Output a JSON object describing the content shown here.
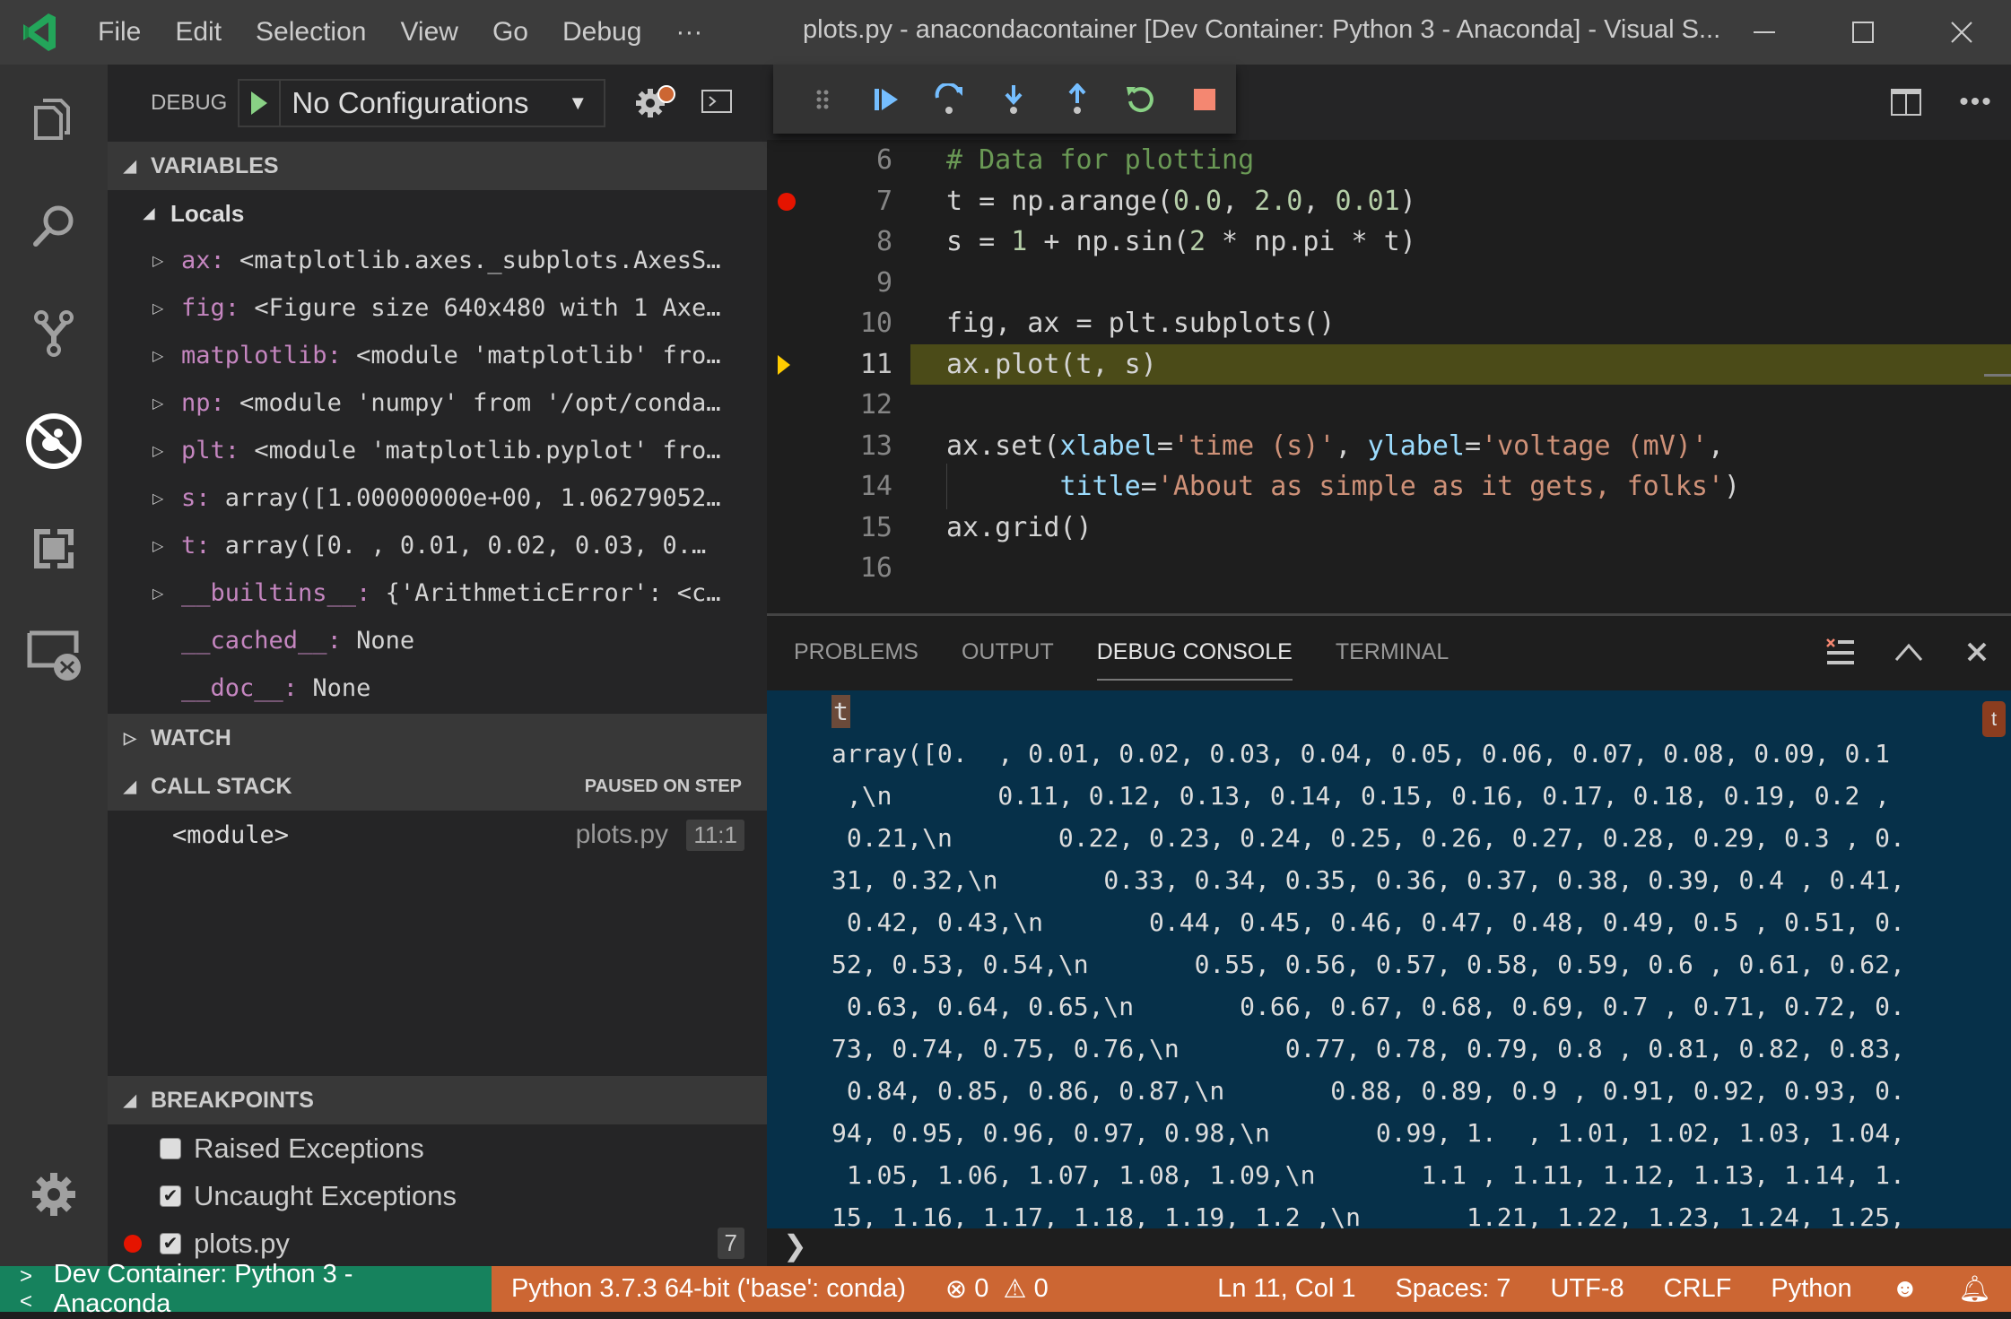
{
  "window": {
    "title": "plots.py - anacondacontainer [Dev Container: Python 3 - Anaconda] - Visual S...",
    "menu": [
      "File",
      "Edit",
      "Selection",
      "View",
      "Go",
      "Debug",
      "···"
    ]
  },
  "activity_bar": [
    "explorer-icon",
    "search-icon",
    "source-control-icon",
    "debug-icon",
    "extensions-icon",
    "remote-explorer-icon",
    "settings-gear-icon"
  ],
  "debug": {
    "label": "DEBUG",
    "configuration": "No Configurations"
  },
  "variables": {
    "header": "VARIABLES",
    "scope": "Locals",
    "items": [
      {
        "name": "ax",
        "value": "<matplotlib.axes._subplots.AxesS…",
        "expandable": true
      },
      {
        "name": "fig",
        "value": "<Figure size 640x480 with 1 Axe…",
        "expandable": true
      },
      {
        "name": "matplotlib",
        "value": "<module 'matplotlib' fro…",
        "expandable": true
      },
      {
        "name": "np",
        "value": "<module 'numpy' from '/opt/conda…",
        "expandable": true
      },
      {
        "name": "plt",
        "value": "<module 'matplotlib.pyplot' fro…",
        "expandable": true
      },
      {
        "name": "s",
        "value": "array([1.00000000e+00, 1.06279052…",
        "expandable": true
      },
      {
        "name": "t",
        "value": "array([0.  , 0.01, 0.02, 0.03, 0.…",
        "expandable": true
      },
      {
        "name": "__builtins__",
        "value": "{'ArithmeticError': <c…",
        "expandable": true
      },
      {
        "name": "__cached__",
        "value": "None",
        "expandable": false
      },
      {
        "name": "__doc__",
        "value": "None",
        "expandable": false
      }
    ]
  },
  "watch": {
    "header": "WATCH"
  },
  "call_stack": {
    "header": "CALL STACK",
    "status": "PAUSED ON STEP",
    "frames": [
      {
        "name": "<module>",
        "file": "plots.py",
        "position": "11:1"
      }
    ]
  },
  "breakpoints": {
    "header": "BREAKPOINTS",
    "items": [
      {
        "label": "Raised Exceptions",
        "checked": false,
        "check": ""
      },
      {
        "label": "Uncaught Exceptions",
        "checked": true,
        "check": "✔"
      },
      {
        "label": "plots.py",
        "checked": true,
        "check": "✔",
        "line": "7"
      }
    ]
  },
  "editor": {
    "lines": [
      {
        "n": "6"
      },
      {
        "n": "7"
      },
      {
        "n": "8"
      },
      {
        "n": "9"
      },
      {
        "n": "10"
      },
      {
        "n": "11"
      },
      {
        "n": "12"
      },
      {
        "n": "13"
      },
      {
        "n": "14"
      },
      {
        "n": "15"
      },
      {
        "n": "16"
      }
    ],
    "tokens": {
      "l6": "# Data for plotting",
      "l7a": "t = np.arange(",
      "l7b": "0.0",
      "l7c": ", ",
      "l7d": "2.0",
      "l7e": ", ",
      "l7f": "0.01",
      "l7g": ")",
      "l8a": "s = ",
      "l8b": "1",
      "l8c": " + np.sin(",
      "l8d": "2",
      "l8e": " * np.pi * t)",
      "l10": "fig, ax = plt.subplots()",
      "l11": "ax.plot(t, s)",
      "l13a": "ax.set(",
      "l13b": "xlabel",
      "l13c": "=",
      "l13d": "'time (s)'",
      "l13e": ", ",
      "l13f": "ylabel",
      "l13g": "=",
      "l13h": "'voltage (mV)'",
      "l13i": ",",
      "l14a": "       ",
      "l14b": "title",
      "l14c": "=",
      "l14d": "'About as simple as it gets, folks'",
      "l14e": ")",
      "l15": "ax.grid()"
    },
    "breakpoint_line": "7",
    "current_line": "11"
  },
  "panel": {
    "tabs": [
      "PROBLEMS",
      "OUTPUT",
      "DEBUG CONSOLE",
      "TERMINAL"
    ],
    "active_tab": "DEBUG CONSOLE",
    "console_echo": "t",
    "console_tag": "t",
    "console_lines": [
      "array([0.  , 0.01, 0.02, 0.03, 0.04, 0.05, 0.06, 0.07, 0.08, 0.09, 0.1",
      " ,\\n       0.11, 0.12, 0.13, 0.14, 0.15, 0.16, 0.17, 0.18, 0.19, 0.2 ,",
      " 0.21,\\n       0.22, 0.23, 0.24, 0.25, 0.26, 0.27, 0.28, 0.29, 0.3 , 0.",
      "31, 0.32,\\n       0.33, 0.34, 0.35, 0.36, 0.37, 0.38, 0.39, 0.4 , 0.41,",
      " 0.42, 0.43,\\n       0.44, 0.45, 0.46, 0.47, 0.48, 0.49, 0.5 , 0.51, 0.",
      "52, 0.53, 0.54,\\n       0.55, 0.56, 0.57, 0.58, 0.59, 0.6 , 0.61, 0.62,",
      " 0.63, 0.64, 0.65,\\n       0.66, 0.67, 0.68, 0.69, 0.7 , 0.71, 0.72, 0.",
      "73, 0.74, 0.75, 0.76,\\n       0.77, 0.78, 0.79, 0.8 , 0.81, 0.82, 0.83,",
      " 0.84, 0.85, 0.86, 0.87,\\n       0.88, 0.89, 0.9 , 0.91, 0.92, 0.93, 0.",
      "94, 0.95, 0.96, 0.97, 0.98,\\n       0.99, 1.  , 1.01, 1.02, 1.03, 1.04,",
      " 1.05, 1.06, 1.07, 1.08, 1.09,\\n       1.1 , 1.11, 1.12, 1.13, 1.14, 1.",
      "15, 1.16, 1.17, 1.18, 1.19, 1.2 ,\\n       1.21, 1.22, 1.23, 1.24, 1.25,"
    ],
    "prompt": "❯"
  },
  "statusbar": {
    "remote": "Dev Container: Python 3 - Anaconda",
    "interpreter": "Python 3.7.3 64-bit ('base': conda)",
    "errors": "0",
    "warnings": "0",
    "position": "Ln 11, Col 1",
    "spaces": "Spaces: 7",
    "encoding": "UTF-8",
    "eol": "CRLF",
    "language": "Python"
  },
  "colors": {
    "statusbar_debug": "#cc6633",
    "remote_indicator": "#16825d",
    "console_bg": "#063049",
    "current_line_bg": "#4b4b18",
    "breakpoint": "#e51400"
  }
}
